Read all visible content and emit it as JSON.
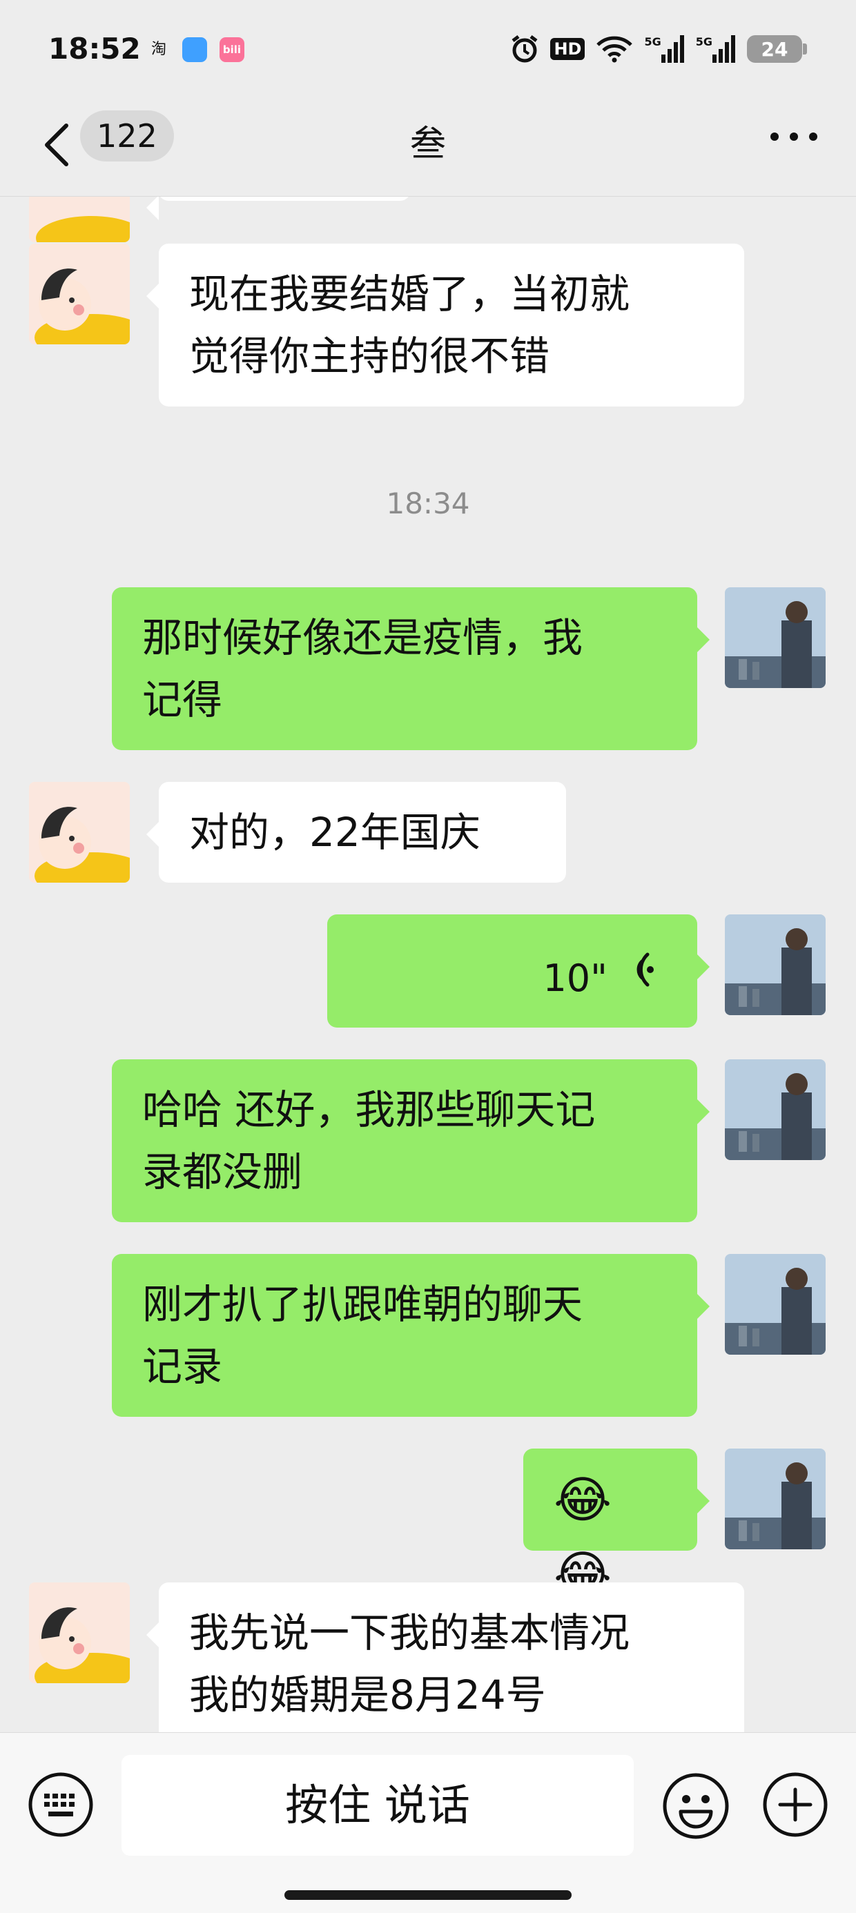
{
  "status_bar": {
    "time": "18:52",
    "apps": [
      "淘",
      "",
      "bili"
    ],
    "hd_label": "HD",
    "signal1": "5G",
    "signal2": "5G",
    "battery": "24"
  },
  "header": {
    "unread_count": "122",
    "title": "叁",
    "back_icon": "chevron-left-icon",
    "more_icon": "more-dots-icon"
  },
  "messages": {
    "m0_partial": "",
    "m1": "现在我要结婚了，当初就\n觉得你主持的很不错",
    "timestamp": "18:34",
    "m2": "那时候好像还是疫情，我\n记得",
    "m3": "对的，22年国庆",
    "m4_voice_duration": "10\"",
    "m5": "哈哈 还好，我那些聊天记\n录都没删",
    "m6": "刚才扒了扒跟唯朝的聊天\n记录",
    "m7_emoji": "😂😂",
    "m8": "我先说一下我的基本情况\n我的婚期是8月24号"
  },
  "input_bar": {
    "talk_label": "按住 说话",
    "keyboard_icon": "keyboard-icon",
    "emoji_icon": "smiley-icon",
    "plus_icon": "plus-circle-icon"
  },
  "colors": {
    "background": "#ededed",
    "outgoing_bubble": "#95ec69",
    "incoming_bubble": "#ffffff",
    "timestamp": "#8c8c8c"
  }
}
